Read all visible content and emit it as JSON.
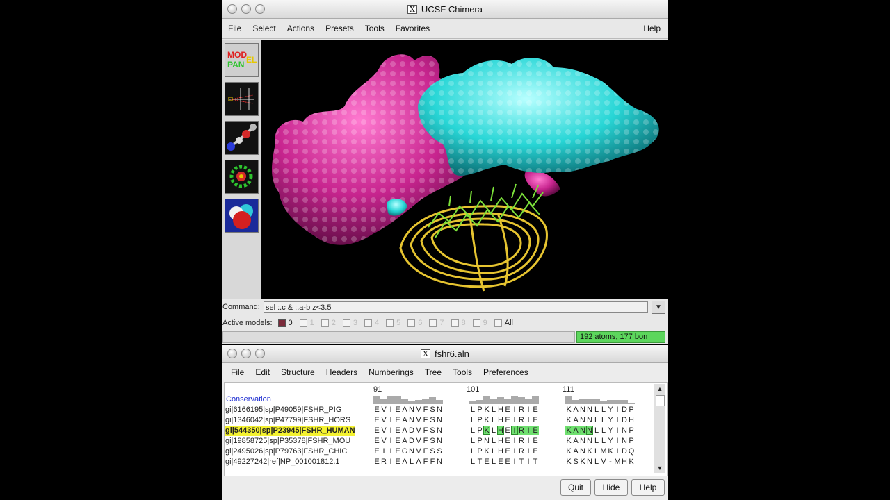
{
  "chimera": {
    "title": "UCSF Chimera",
    "menu": [
      "File",
      "Select",
      "Actions",
      "Presets",
      "Tools",
      "Favorites"
    ],
    "help": "Help",
    "tools": [
      "model-panel",
      "side-view",
      "ball-stick",
      "ribbon",
      "sphere"
    ],
    "model_panel_logo": {
      "top_left": "MOD",
      "top_right": "EL",
      "bottom": "PAN"
    },
    "command_label": "Command:",
    "command_value": "sel :.c & :.a-b z<3.5",
    "active_models_label": "Active models:",
    "models": [
      {
        "num": "0",
        "on": true
      },
      {
        "num": "1",
        "on": false
      },
      {
        "num": "2",
        "on": false
      },
      {
        "num": "3",
        "on": false
      },
      {
        "num": "4",
        "on": false
      },
      {
        "num": "5",
        "on": false
      },
      {
        "num": "6",
        "on": false
      },
      {
        "num": "7",
        "on": false
      },
      {
        "num": "8",
        "on": false
      },
      {
        "num": "9",
        "on": false
      }
    ],
    "all_label": "All",
    "status": "192 atoms, 177 bon"
  },
  "alignment": {
    "title": "fshr6.aln",
    "menu": [
      "File",
      "Edit",
      "Structure",
      "Headers",
      "Numberings",
      "Tree",
      "Tools",
      "Preferences"
    ],
    "ruler": [
      "91",
      "101",
      "111"
    ],
    "conservation_label": "Conservation",
    "sequences": [
      {
        "name": "gi|6166195|sp|P49059|FSHR_PIG",
        "highlight": false,
        "b1": "EVIEANVFSN",
        "b2": "LPKLHEIRIE",
        "b3": "KANNLLYIDP"
      },
      {
        "name": "gi|1346042|sp|P47799|FSHR_HORS",
        "highlight": false,
        "b1": "EVIEANVFSN",
        "b2": "LPKLHEIRIE",
        "b3": "KANNLLYIDH"
      },
      {
        "name": "gi|544350|sp|P23945|FSHR_HUMAN",
        "highlight": true,
        "b1": "EVIEADVFSN",
        "b2": "LPKLHEIRIE",
        "b3": "KANNLLYINP"
      },
      {
        "name": "gi|19858725|sp|P35378|FSHR_MOU",
        "highlight": false,
        "b1": "EVIEADVFSN",
        "b2": "LPNLHEIRIE",
        "b3": "KANNLLYINP"
      },
      {
        "name": "gi|2495026|sp|P79763|FSHR_CHIC",
        "highlight": false,
        "b1": "EIIEGNVFSS",
        "b2": "LPKLHEIRIE",
        "b3": "KANKLMKIDQ"
      },
      {
        "name": "gi|49227242|ref|NP_001001812.1",
        "highlight": false,
        "b1": "ERIEALAFFN",
        "b2": "LTELEEITIT",
        "b3": "KSKNLV-MHK"
      }
    ],
    "buttons": {
      "quit": "Quit",
      "hide": "Hide",
      "help": "Help"
    }
  },
  "colors": {
    "magenta": "#c8258f",
    "cyan": "#28d6d6",
    "ribbon": "#e6c430",
    "stick": "#7be03a",
    "name_highlight": "#f4f230",
    "residue_highlight": "#6fe06f"
  }
}
